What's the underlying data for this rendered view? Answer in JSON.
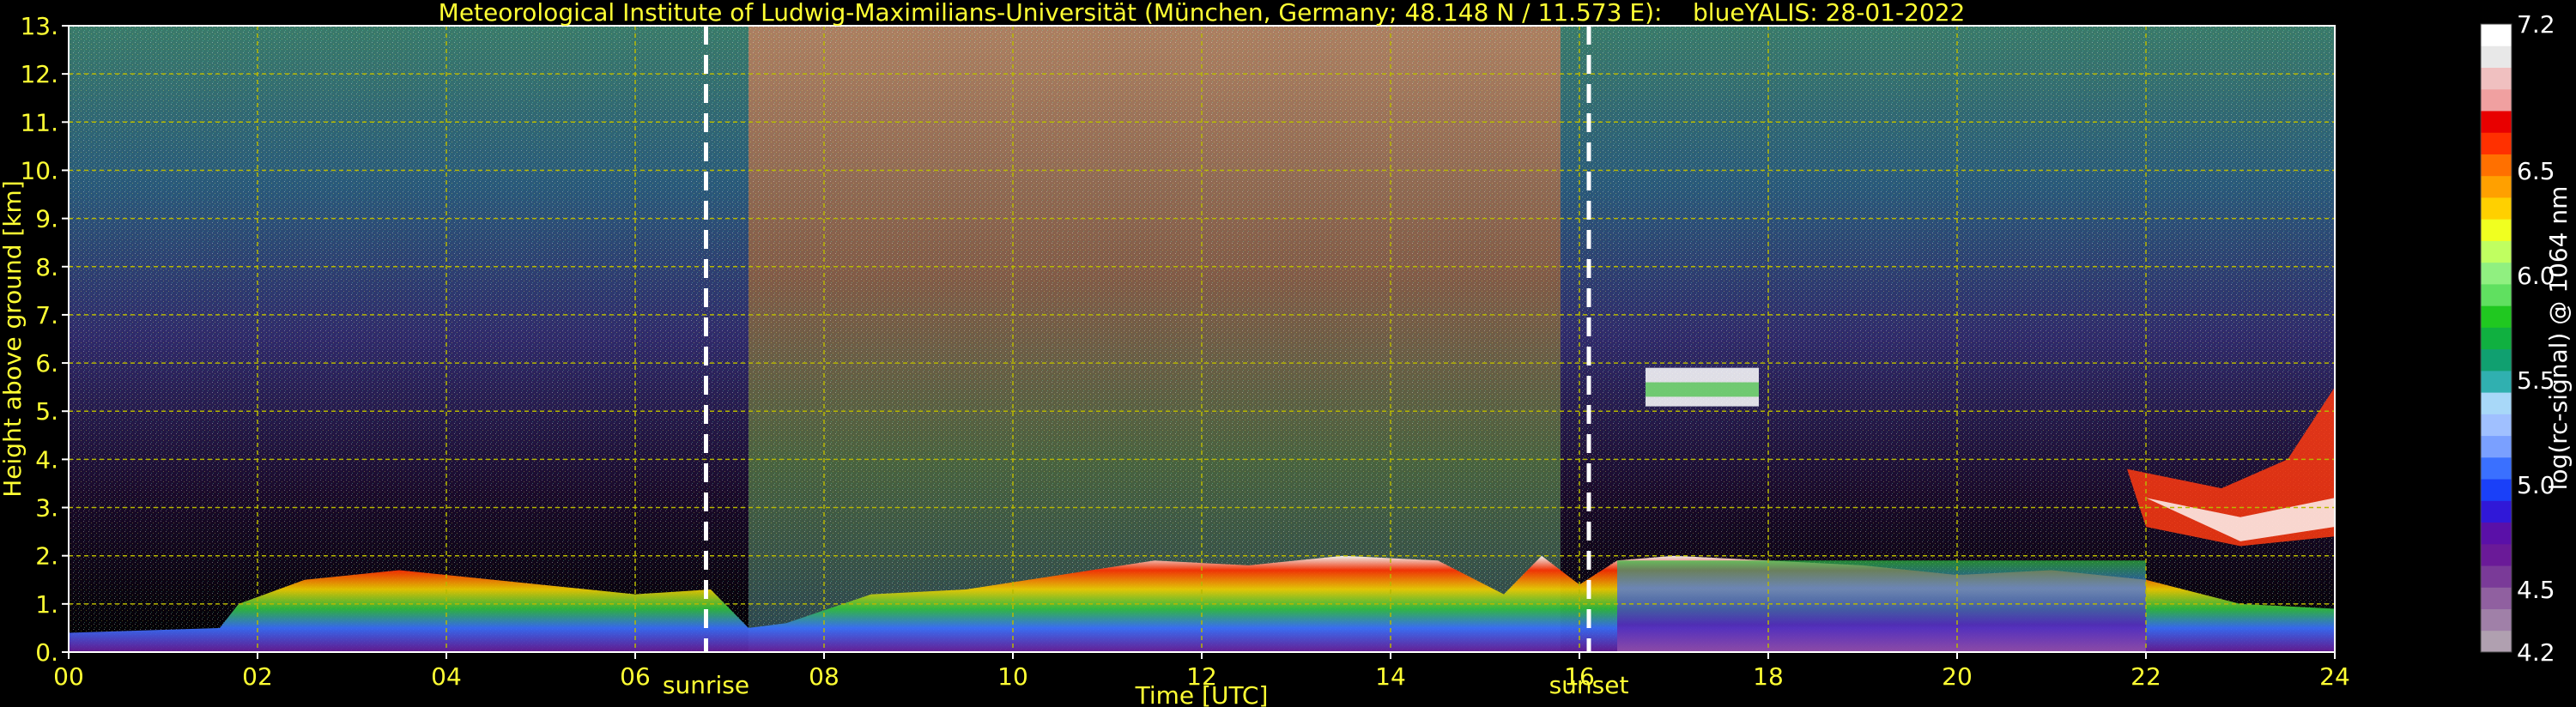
{
  "colors": {
    "annotation": "#ffff33",
    "grid": "#b8b800",
    "white": "#ffffff",
    "background": "#000000"
  },
  "chart_data": {
    "type": "heatmap",
    "title": "Meteorological Institute of Ludwig-Maximilians-Universität (München, Germany; 48.148 N / 11.573 E):    blueYALIS: 28-01-2022",
    "xlabel": "Time [UTC]",
    "ylabel": "Height above ground [km]",
    "xlim": [
      0,
      24
    ],
    "ylim": [
      0,
      13
    ],
    "x_ticks": [
      "00",
      "02",
      "04",
      "06",
      "08",
      "10",
      "12",
      "14",
      "16",
      "18",
      "20",
      "22",
      "24"
    ],
    "y_ticks": [
      "0.",
      "1.",
      "2.",
      "3.",
      "4.",
      "5.",
      "6.",
      "7.",
      "8.",
      "9.",
      "10.",
      "11.",
      "12.",
      "13."
    ],
    "grid": true,
    "markers": [
      {
        "label": "sunrise",
        "x": 6.75
      },
      {
        "label": "sunset",
        "x": 16.1
      }
    ],
    "colorbar": {
      "label": "log(rc-signal) @ 1064 nm",
      "range": [
        4.2,
        7.2
      ],
      "ticks": [
        "7.2",
        "6.5",
        "6.0",
        "5.5",
        "5.0",
        "4.5",
        "4.2"
      ],
      "tick_values": [
        7.2,
        6.5,
        6.0,
        5.5,
        5.0,
        4.5,
        4.2
      ],
      "colors": [
        "#b0a0b0",
        "#a080a8",
        "#9060a0",
        "#7a3a98",
        "#6a1a98",
        "#5a10a8",
        "#3018d8",
        "#1a40f8",
        "#3a70ff",
        "#7aa0ff",
        "#a0c0ff",
        "#a8d8f8",
        "#30b0b0",
        "#10a070",
        "#10b040",
        "#20c820",
        "#60e060",
        "#90f080",
        "#c0ff60",
        "#f0ff20",
        "#ffd000",
        "#ffa000",
        "#ff7000",
        "#ff3000",
        "#e80000",
        "#f0a0a0",
        "#f0c0c0",
        "#e8e8e8",
        "#ffffff"
      ]
    }
  }
}
